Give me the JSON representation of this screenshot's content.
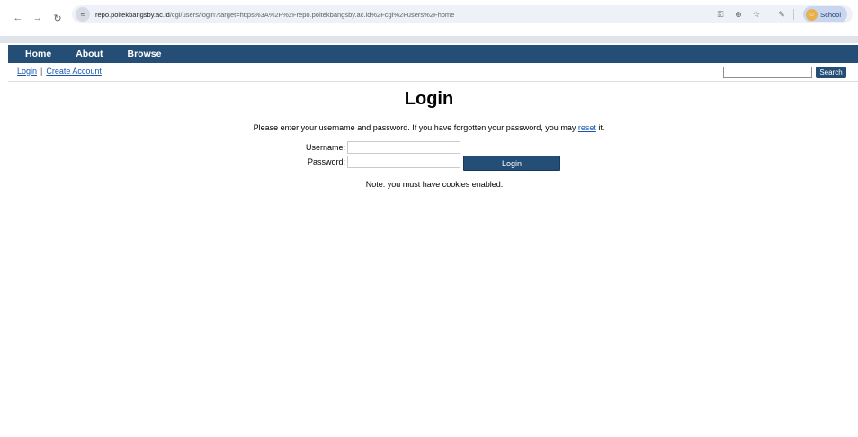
{
  "browser": {
    "url_host": "repo.poltekbangsby.ac.id",
    "url_path": "/cgi/users/login?target=https%3A%2F%2Frepo.poltekbangsby.ac.id%2Fcgi%2Fusers%2Fhome",
    "profile_label": "School"
  },
  "nav": {
    "items": [
      "Home",
      "About",
      "Browse"
    ]
  },
  "account": {
    "login_label": "Login",
    "separator": "|",
    "create_label": "Create Account"
  },
  "search": {
    "value": "",
    "button_label": "Search"
  },
  "login": {
    "title": "Login",
    "intro_before": "Please enter your username and password. If you have forgotten your password, you may ",
    "intro_link": "reset",
    "intro_after": " it.",
    "username_label": "Username:",
    "password_label": "Password:",
    "username_value": "",
    "password_value": "",
    "button_label": "Login",
    "note": "Note: you must have cookies enabled."
  }
}
